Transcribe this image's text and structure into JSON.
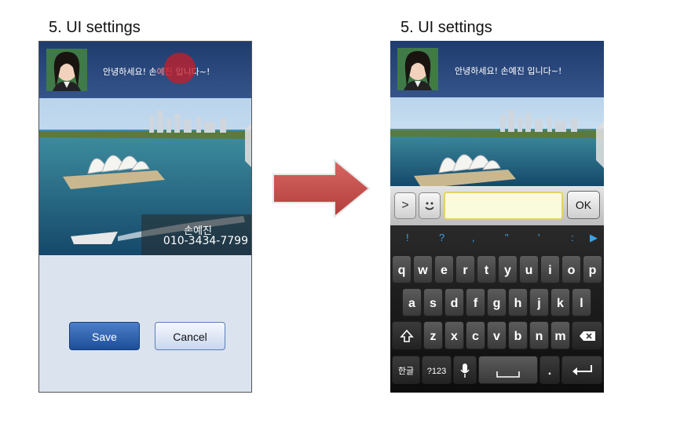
{
  "left_title": "5. UI settings",
  "right_title": "5. UI settings",
  "greeting": {
    "pre": "안녕하세요! 손",
    "highlight": "예진",
    "post": " 입니다~!"
  },
  "greeting_full": "안녕하세요! 손예진 입니다~!",
  "contact": {
    "name": "손예진",
    "phone": "010-3434-7799"
  },
  "buttons": {
    "save": "Save",
    "cancel": "Cancel"
  },
  "input_bar": {
    "expand_glyph": ">",
    "emoji_glyph": "😊",
    "ok": "OK"
  },
  "keyboard": {
    "symbols": [
      "!",
      "?",
      ",",
      "\"",
      "'",
      ":",
      "▶"
    ],
    "row1": [
      "q",
      "w",
      "e",
      "r",
      "t",
      "y",
      "u",
      "i",
      "o",
      "p"
    ],
    "row2": [
      "a",
      "s",
      "d",
      "f",
      "g",
      "h",
      "j",
      "k",
      "l"
    ],
    "row3": [
      "z",
      "x",
      "c",
      "v",
      "b",
      "n",
      "m"
    ],
    "bottom": {
      "lang": "한글",
      "numsym": "?123",
      "period": "."
    }
  },
  "colors": {
    "header": "#2b4a80",
    "touch_indicator": "#c81e28",
    "arrow": "#c9504d",
    "save": "#2a5ea8"
  }
}
